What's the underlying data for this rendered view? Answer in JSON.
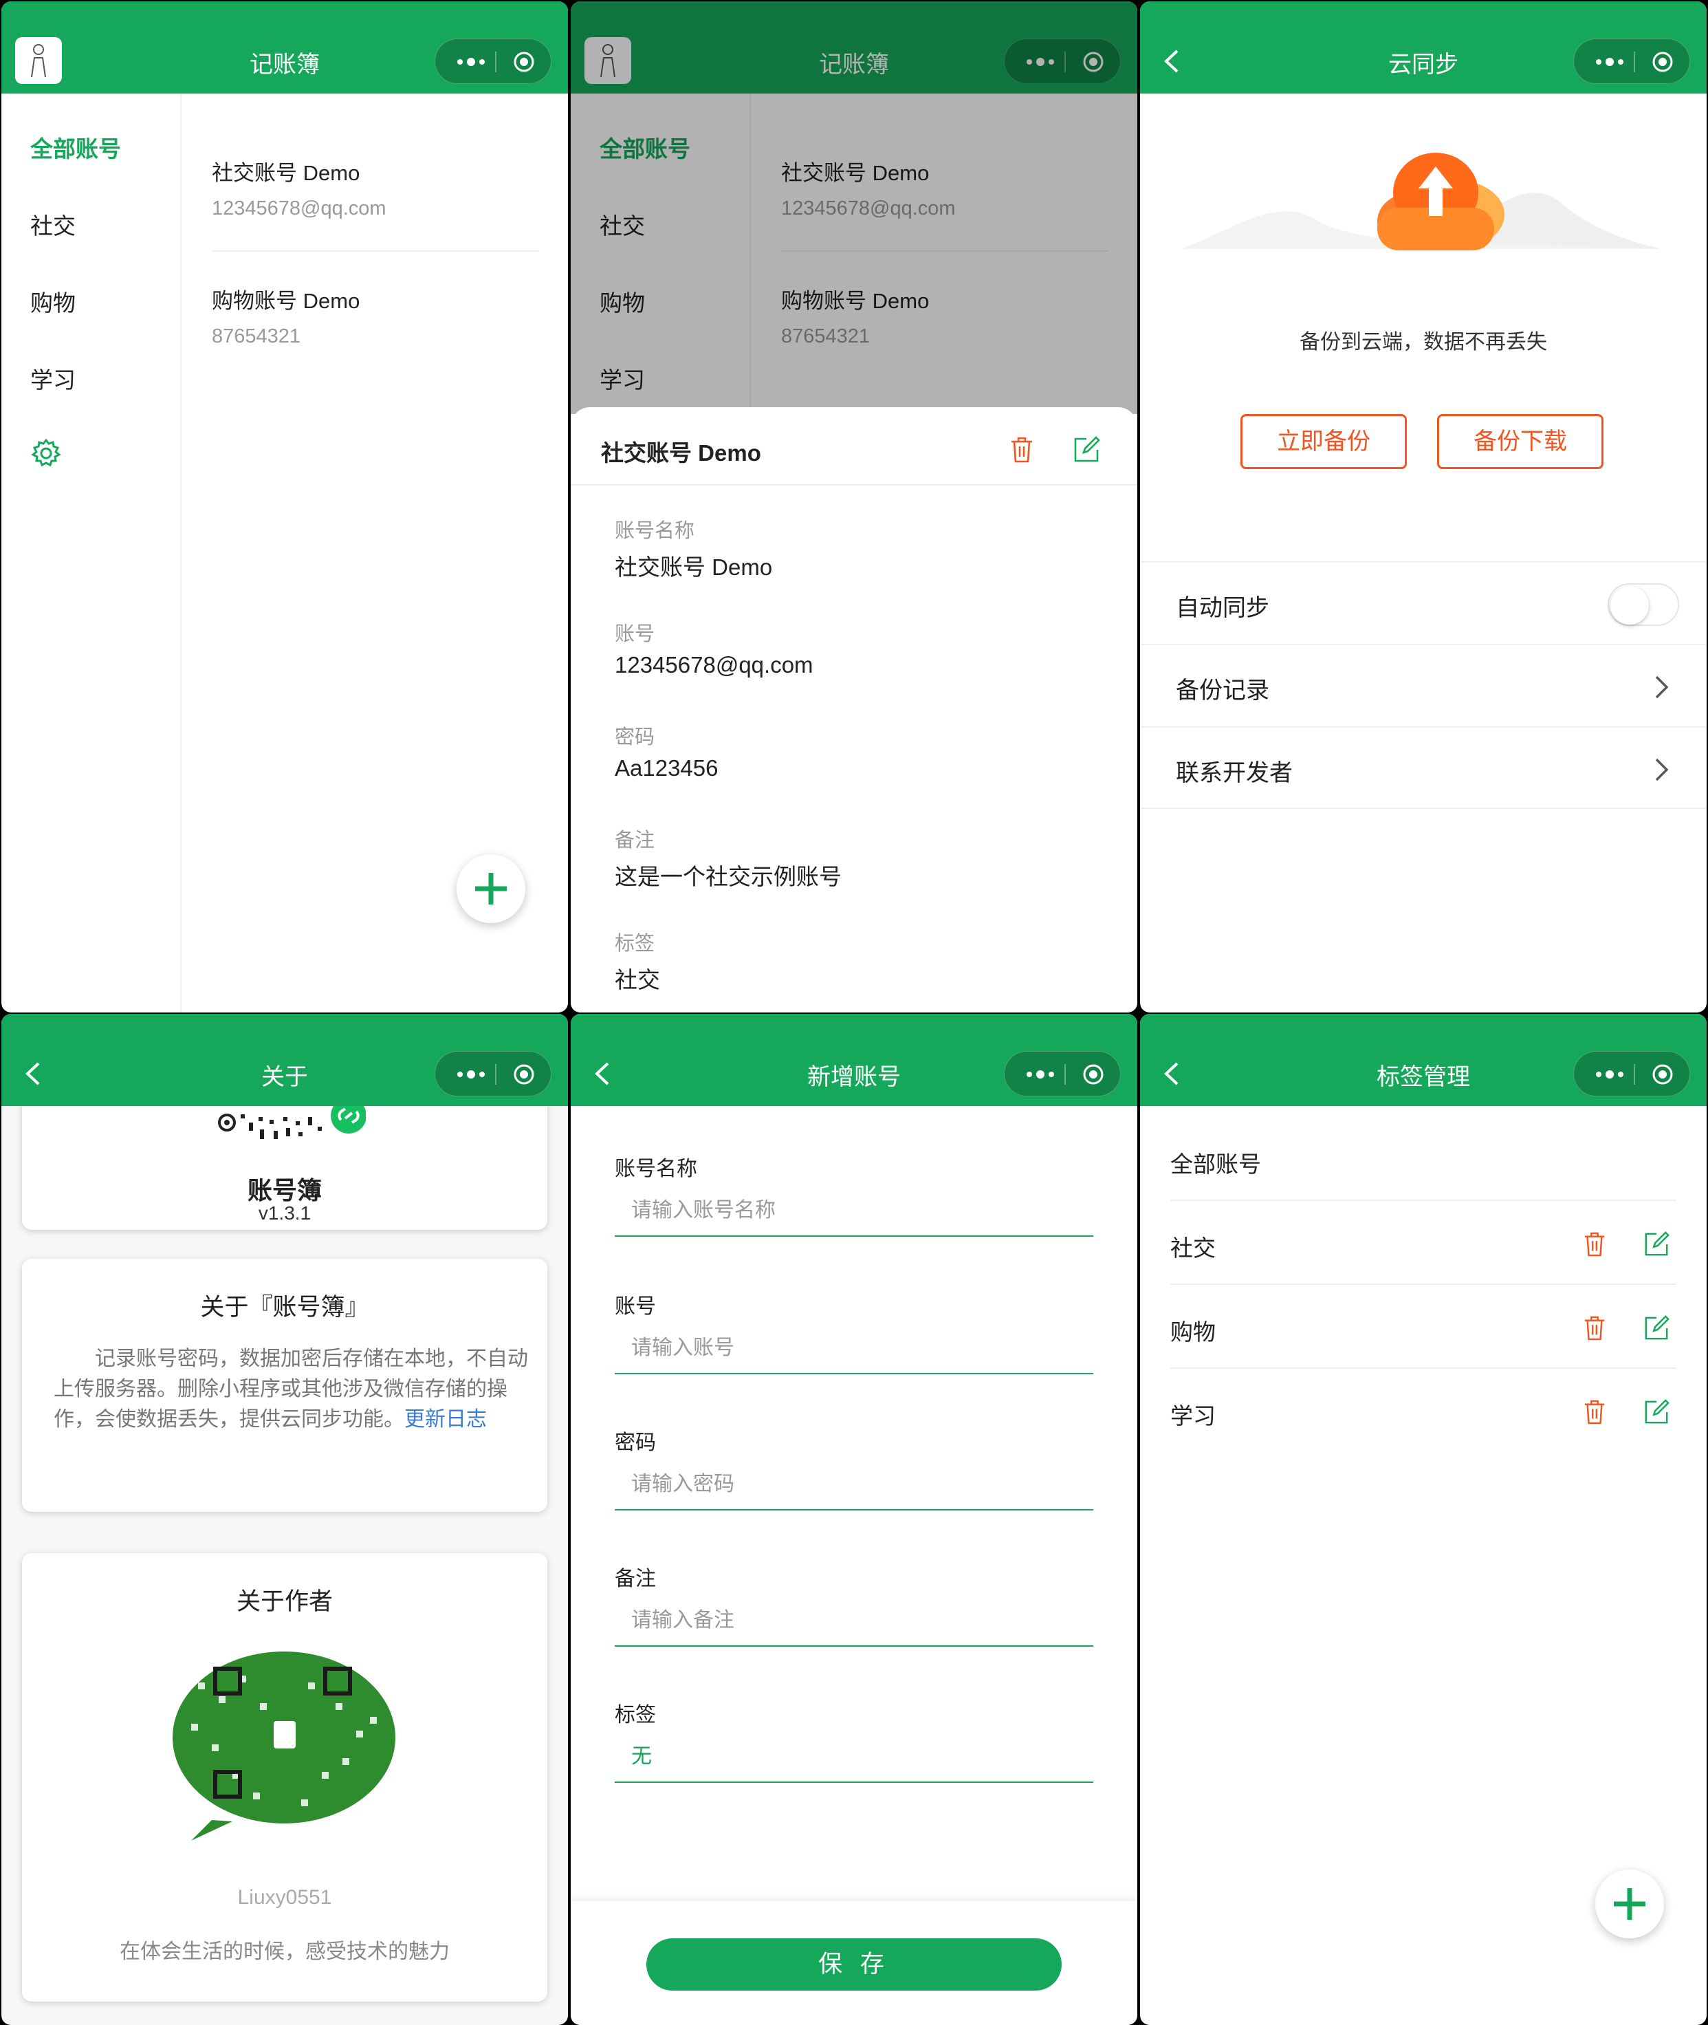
{
  "colors": {
    "primary": "#16a85a",
    "danger": "#f05522",
    "link": "#3a7bd5"
  },
  "panel1": {
    "title": "记账簿",
    "sidebar": [
      "全部账号",
      "社交",
      "购物",
      "学习"
    ],
    "accounts": [
      {
        "name": "社交账号 Demo",
        "account": "12345678@qq.com"
      },
      {
        "name": "购物账号 Demo",
        "account": "87654321"
      }
    ]
  },
  "panel2": {
    "title": "记账簿",
    "sidebar": [
      "全部账号",
      "社交",
      "购物",
      "学习"
    ],
    "accounts": [
      {
        "name": "社交账号 Demo",
        "account": "12345678@qq.com"
      },
      {
        "name": "购物账号 Demo",
        "account": "87654321"
      }
    ],
    "sheet": {
      "title": "社交账号 Demo",
      "fields": [
        {
          "label": "账号名称",
          "value": "社交账号 Demo"
        },
        {
          "label": "账号",
          "value": "12345678@qq.com"
        },
        {
          "label": "密码",
          "value": "Aa123456"
        },
        {
          "label": "备注",
          "value": "这是一个社交示例账号"
        },
        {
          "label": "标签",
          "value": "社交"
        }
      ]
    }
  },
  "panel3": {
    "title": "云同步",
    "tagline": "备份到云端，数据不再丢失",
    "backup_now": "立即备份",
    "backup_download": "备份下载",
    "rows": [
      "自动同步",
      "备份记录",
      "联系开发者"
    ],
    "auto_sync_on": false
  },
  "panel4": {
    "title": "关于",
    "app_name": "账号簿",
    "version": "v1.3.1",
    "about_title": "关于『账号簿』",
    "about_text": "记录账号密码，数据加密后存储在本地，不自动上传服务器。删除小程序或其他涉及微信存储的操作，会使数据丢失，提供云同步功能。",
    "changelog_link": "更新日志",
    "author_title": "关于作者",
    "author_name": "Liuxy0551",
    "author_motto": "在体会生活的时候，感受技术的魅力"
  },
  "panel5": {
    "title": "新增账号",
    "fields": [
      {
        "label": "账号名称",
        "placeholder": "请输入账号名称"
      },
      {
        "label": "账号",
        "placeholder": "请输入账号"
      },
      {
        "label": "密码",
        "placeholder": "请输入密码"
      },
      {
        "label": "备注",
        "placeholder": "请输入备注"
      }
    ],
    "tag_label": "标签",
    "tag_value": "无",
    "save": "保 存"
  },
  "panel6": {
    "title": "标签管理",
    "all_label": "全部账号",
    "tags": [
      "社交",
      "购物",
      "学习"
    ]
  }
}
